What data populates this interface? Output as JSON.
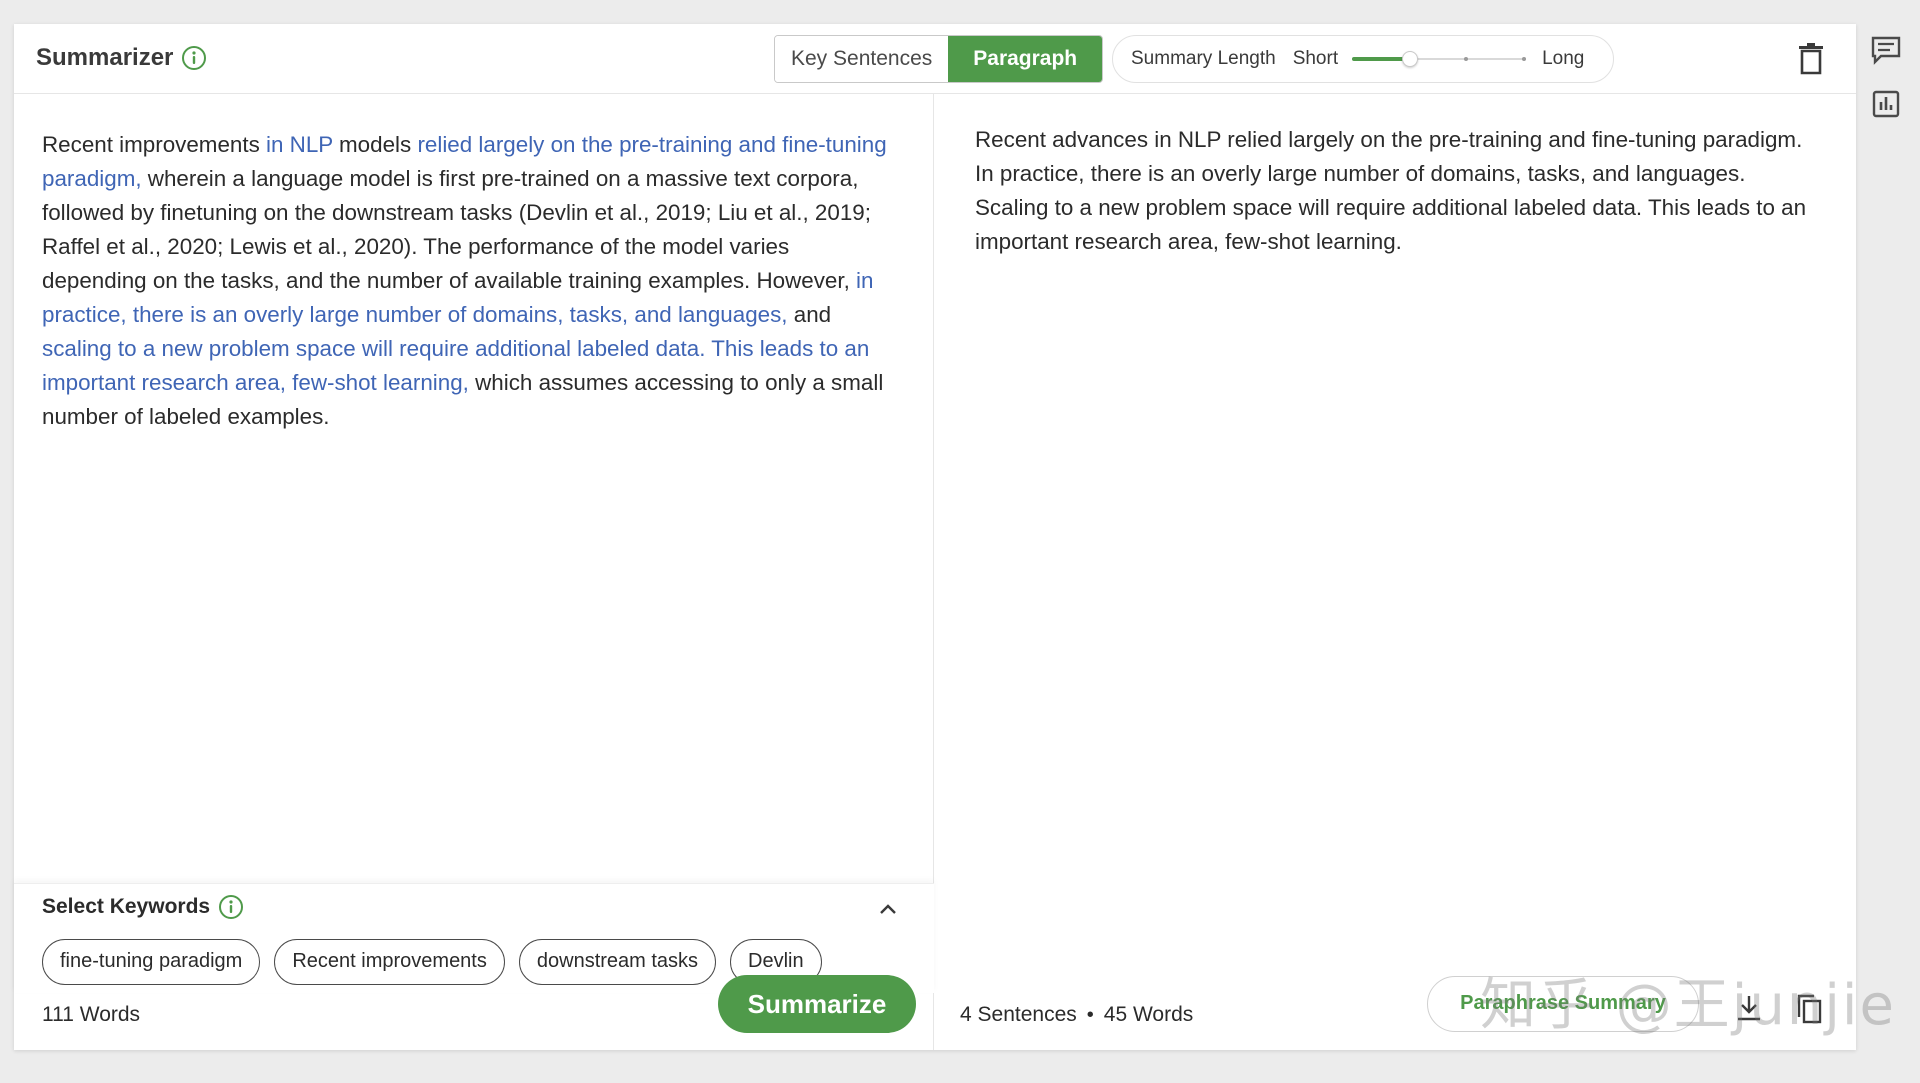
{
  "header": {
    "title": "Summarizer",
    "modes": [
      {
        "label": "Key Sentences",
        "active": false
      },
      {
        "label": "Paragraph",
        "active": true
      }
    ],
    "summary_length": {
      "label": "Summary Length",
      "min_label": "Short",
      "max_label": "Long",
      "value": 0.33
    }
  },
  "source": {
    "segments": [
      {
        "text": "Recent improvements ",
        "highlight": false
      },
      {
        "text": "in NLP",
        "highlight": true
      },
      {
        "text": " models ",
        "highlight": false
      },
      {
        "text": "relied largely on the pre-training and fine-tuning paradigm,",
        "highlight": true
      },
      {
        "text": " wherein a language model is first pre-trained on a massive text corpora, followed by finetuning on the downstream tasks (Devlin et al., 2019; Liu et al., 2019; Raffel et al., 2020; Lewis et al., 2020). The performance of the model varies depending on the tasks, and the number of available training examples. However, ",
        "highlight": false
      },
      {
        "text": "in practice, there is an overly large number of domains, tasks, and languages,",
        "highlight": true
      },
      {
        "text": " and ",
        "highlight": false
      },
      {
        "text": "scaling to a new problem space will require additional labeled data. This leads to an important research area, few-shot learning,",
        "highlight": true
      },
      {
        "text": " which assumes accessing to only a small number of labeled examples.",
        "highlight": false
      }
    ]
  },
  "keywords": {
    "title": "Select Keywords",
    "chips": [
      "fine-tuning paradigm",
      "Recent improvements",
      "downstream tasks",
      "Devlin"
    ]
  },
  "left_footer": {
    "word_count": "111 Words",
    "summarize_label": "Summarize"
  },
  "summary": {
    "text": "Recent advances in NLP relied largely on the pre-training and fine-tuning paradigm. In practice, there is an overly large number of domains, tasks, and languages. Scaling to a new problem space will require additional labeled data. This leads to an important research area, few-shot learning."
  },
  "right_footer": {
    "sentences": "4 Sentences",
    "separator": "•",
    "words": "45 Words",
    "paraphrase_label": "Paraphrase Summary"
  },
  "watermark": "知乎 @王junjie",
  "icons": {
    "title_info": "info-icon",
    "keywords_info": "info-icon",
    "trash": "trash-icon",
    "side_top": "comment-icon",
    "side_bottom": "chart-icon",
    "chevron": "chevron-up-icon",
    "download": "download-icon",
    "copy": "copy-icon"
  },
  "colors": {
    "accent_green": "#4f9a4a",
    "highlight_blue": "#3f65b5"
  }
}
